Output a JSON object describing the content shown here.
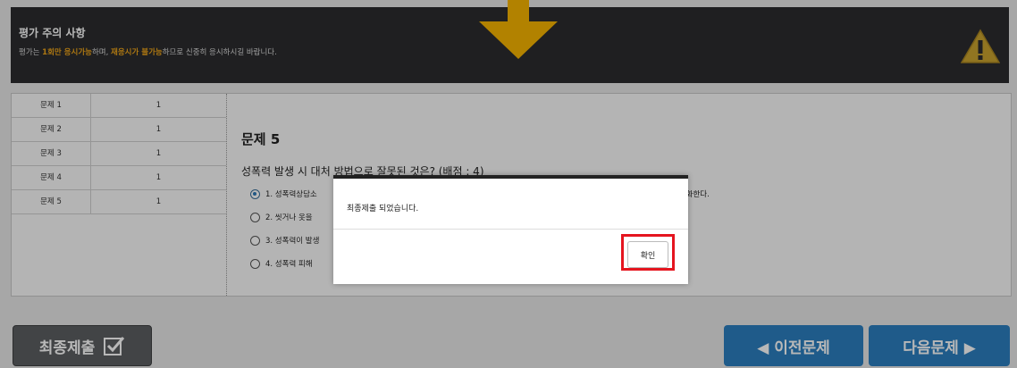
{
  "notice": {
    "title": "평가 주의 사항",
    "text_prefix": "평가는 ",
    "text_hl1": "1회만 응시가능",
    "text_mid": "하며, ",
    "text_hl2": "재응시가 불가능",
    "text_suffix": "하므로 신중히 응시하시길 바랍니다."
  },
  "question_list": [
    {
      "label": "문제 1",
      "value": "1"
    },
    {
      "label": "문제 2",
      "value": "1"
    },
    {
      "label": "문제 3",
      "value": "1"
    },
    {
      "label": "문제 4",
      "value": "1"
    },
    {
      "label": "문제 5",
      "value": "1"
    }
  ],
  "question": {
    "title": "문제 5",
    "text": "성폭력 발생 시 대처 방법으로 잘못된 것은? (배점 : 4)",
    "options": [
      {
        "label": "1. 성폭력상담소",
        "tail": "366 등으로 전화한다."
      },
      {
        "label": "2. 씻거나 옷을 ",
        "tail": ""
      },
      {
        "label": "3. 성폭력이 발생",
        "tail": ""
      },
      {
        "label": "4. 성폭력 피해 ",
        "tail": ""
      }
    ],
    "selected": 0
  },
  "buttons": {
    "final_submit": "최종제출",
    "prev": "◀  이전문제",
    "next": "다음문제  ▶"
  },
  "dialog": {
    "message": "최종제출 되었습니다.",
    "ok": "확인"
  },
  "colors": {
    "accent": "#2c7fc0",
    "highlight": "#f0a619",
    "alert_outline": "#e5151f"
  }
}
